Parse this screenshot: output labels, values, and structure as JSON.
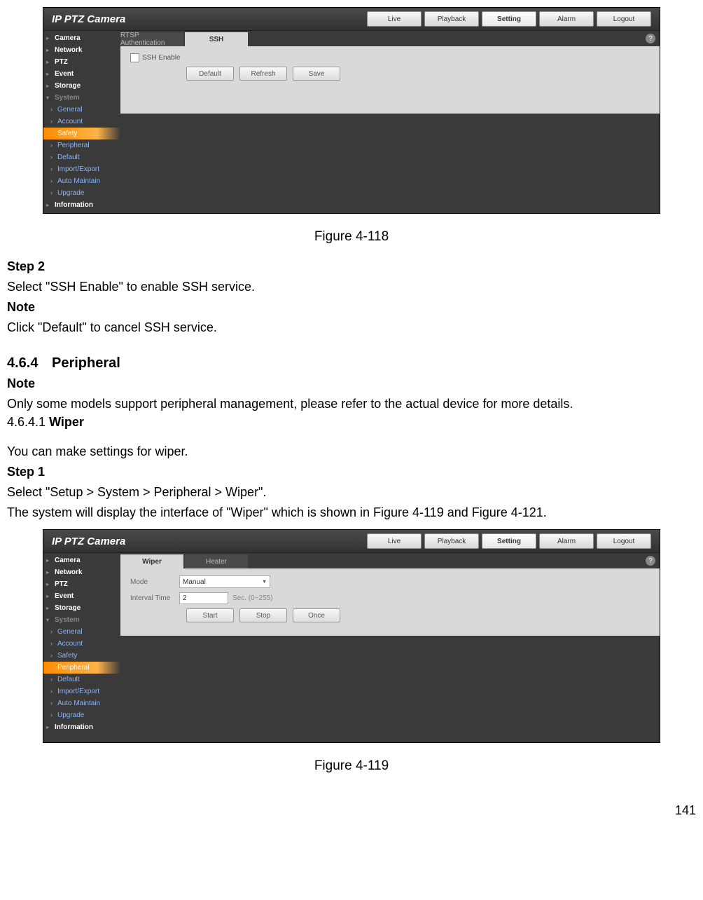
{
  "ui_common": {
    "logo": "IP PTZ Camera",
    "top_buttons": [
      "Live",
      "Playback",
      "Setting",
      "Alarm",
      "Logout"
    ],
    "top_active": "Setting",
    "help_symbol": "?"
  },
  "ui1": {
    "tabs": [
      {
        "label": "RTSP Authentication",
        "active": false
      },
      {
        "label": "SSH",
        "active": true
      }
    ],
    "sidebar": [
      {
        "label": "Camera",
        "type": "top"
      },
      {
        "label": "Network",
        "type": "top"
      },
      {
        "label": "PTZ",
        "type": "top"
      },
      {
        "label": "Event",
        "type": "top"
      },
      {
        "label": "Storage",
        "type": "top"
      },
      {
        "label": "System",
        "type": "topopen"
      },
      {
        "label": "General",
        "type": "sub"
      },
      {
        "label": "Account",
        "type": "sub"
      },
      {
        "label": "Safety",
        "type": "sub",
        "active": true
      },
      {
        "label": "Peripheral",
        "type": "sub"
      },
      {
        "label": "Default",
        "type": "sub"
      },
      {
        "label": "Import/Export",
        "type": "sub"
      },
      {
        "label": "Auto Maintain",
        "type": "sub"
      },
      {
        "label": "Upgrade",
        "type": "sub"
      },
      {
        "label": "Information",
        "type": "top"
      }
    ],
    "checkbox_label": "SSH Enable",
    "buttons": [
      "Default",
      "Refresh",
      "Save"
    ]
  },
  "ui2": {
    "tabs": [
      {
        "label": "Wiper",
        "active": true
      },
      {
        "label": "Heater",
        "active": false
      }
    ],
    "sidebar": [
      {
        "label": "Camera",
        "type": "top"
      },
      {
        "label": "Network",
        "type": "top"
      },
      {
        "label": "PTZ",
        "type": "top"
      },
      {
        "label": "Event",
        "type": "top"
      },
      {
        "label": "Storage",
        "type": "top"
      },
      {
        "label": "System",
        "type": "topopen"
      },
      {
        "label": "General",
        "type": "sub"
      },
      {
        "label": "Account",
        "type": "sub"
      },
      {
        "label": "Safety",
        "type": "sub"
      },
      {
        "label": "Peripheral",
        "type": "sub",
        "active": true
      },
      {
        "label": "Default",
        "type": "sub"
      },
      {
        "label": "Import/Export",
        "type": "sub"
      },
      {
        "label": "Auto Maintain",
        "type": "sub"
      },
      {
        "label": "Upgrade",
        "type": "sub"
      },
      {
        "label": "Information",
        "type": "top"
      }
    ],
    "mode_label": "Mode",
    "mode_value": "Manual",
    "interval_label": "Interval Time",
    "interval_value": "2",
    "interval_hint": "Sec. (0~255)",
    "buttons": [
      "Start",
      "Stop",
      "Once"
    ]
  },
  "doc": {
    "fig1": "Figure 4-118",
    "step2": "Step 2",
    "step2_text": "Select \"SSH Enable\" to enable SSH service.",
    "note1_label": "Note",
    "note1_text": "Click \"Default\" to cancel SSH service.",
    "section_num": "4.6.4",
    "section_title": "Peripheral",
    "note2_label": "Note",
    "note2_text": "Only some models support peripheral management, please refer to the actual device for more details.",
    "subsection": "4.6.4.1",
    "subsection_title": "Wiper",
    "wiper_intro": "You can make settings for wiper.",
    "step1": "Step 1",
    "step1_text": "Select \"Setup > System > Peripheral > Wiper\".",
    "step1_text2": "The system will display the interface of \"Wiper\" which is shown in Figure 4-119 and Figure 4-121.",
    "fig2": "Figure 4-119",
    "page_number": "141"
  }
}
